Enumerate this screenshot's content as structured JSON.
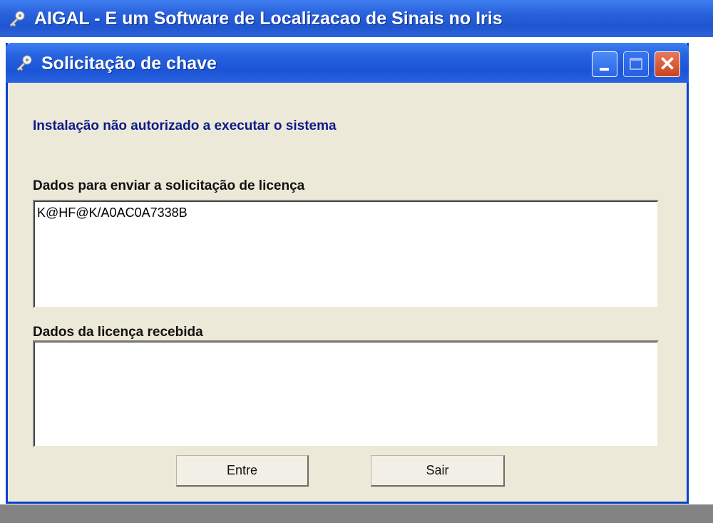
{
  "app_window": {
    "title": "AIGAL - E um Software de Localizacao de Sinais no Iris",
    "icon": "key-icon"
  },
  "dialog": {
    "title": "Solicitação de chave",
    "icon": "key-icon",
    "controls": {
      "minimize": "minimize-button",
      "maximize": "maximize-button",
      "close": "close-button"
    },
    "warning_text": "Instalação não autorizado a executar o sistema",
    "request_label": "Dados para enviar a solicitação de licença",
    "request_value": "K@HF@K/A0AC0A7338B",
    "license_label": "Dados da licença recebida",
    "license_value": "",
    "buttons": {
      "enter_label": "Entre",
      "exit_label": "Sair"
    }
  },
  "colors": {
    "titlebar": "#2a63dd",
    "dialog_bg": "#ece9d8",
    "warning_text": "#0c1a8a",
    "close_button": "#d9562f"
  }
}
